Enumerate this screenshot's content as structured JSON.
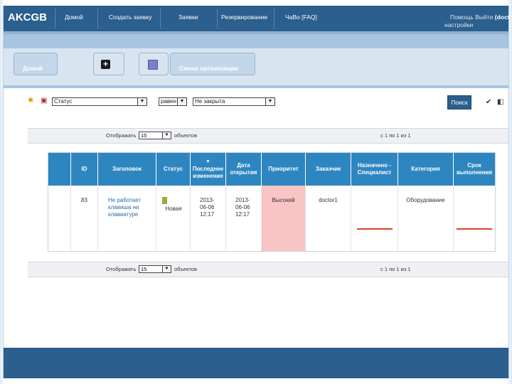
{
  "app": {
    "logo": "AKCGB"
  },
  "nav": {
    "items": [
      "Домой",
      "Создать заявку",
      "Заявки",
      "Резервирование",
      "ЧаВо [FAQ]"
    ],
    "help_logout": "Помощь Выйти",
    "username": "(doct",
    "settings": "настройки"
  },
  "toolbar": {
    "home_label": "Домой",
    "add_icon": "plus-icon",
    "edit_icon": "edit-icon",
    "change_org_label": "Смена организации"
  },
  "filter": {
    "field": "Статус",
    "operator": "равен",
    "value": "Не закрыта",
    "search_label": "Поиск"
  },
  "pager_top": {
    "show_prefix": "Отображать",
    "per_page": "15",
    "show_suffix": "объектов",
    "range": "с 1 по 1 из 1"
  },
  "pager_bottom": {
    "show_prefix": "Отображать",
    "per_page": "15",
    "show_suffix": "объектов",
    "range": "с 1 по 1 из 1"
  },
  "table": {
    "sort_indicator": "▼",
    "headers": [
      "ID",
      "Заголовок",
      "Статус",
      "Последнее изменение",
      "Дата открытия",
      "Приоритет",
      "Заказчик",
      "Назначено - Специалист",
      "Категория",
      "Срок выполнения"
    ],
    "rows": [
      {
        "id": "83",
        "title": "Не работает клавиша на клавиатуре",
        "status": "Новая",
        "last_change": "2013-06-06 12:17",
        "opened": "2013-06-06 12:17",
        "priority": "Высокий",
        "customer": "doctor1",
        "assigned": "",
        "category": "Оборудование",
        "deadline": ""
      }
    ]
  },
  "colors": {
    "nav": "#2a5f8e",
    "header": "#2e86c1",
    "priority_high": "#f9c4c4",
    "status_new": "#9caa3b"
  }
}
